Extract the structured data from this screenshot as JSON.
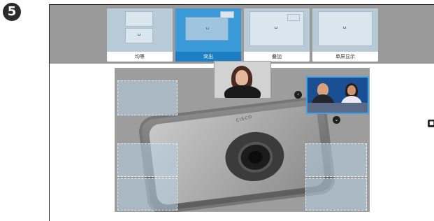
{
  "step": {
    "number": "5"
  },
  "layout_options": [
    {
      "label": "均等",
      "selected": false
    },
    {
      "label": "突出",
      "selected": true
    },
    {
      "label": "叠加",
      "selected": false
    },
    {
      "label": "单屏显示",
      "selected": false
    }
  ],
  "device": {
    "brand": "CISCO"
  },
  "icons": {
    "step": "number-five-badge",
    "move_left": "chevron-left-icon",
    "move_down": "chevron-down-icon",
    "lock": "lock-icon",
    "monitor": "monitor-icon"
  },
  "colors": {
    "selected_option": "#2f8fd0",
    "option_bg": "#dbe7ef",
    "top_bar": "#9a9a9a",
    "stage": "#9d9d9d",
    "remote_border": "#3fa2e8"
  }
}
